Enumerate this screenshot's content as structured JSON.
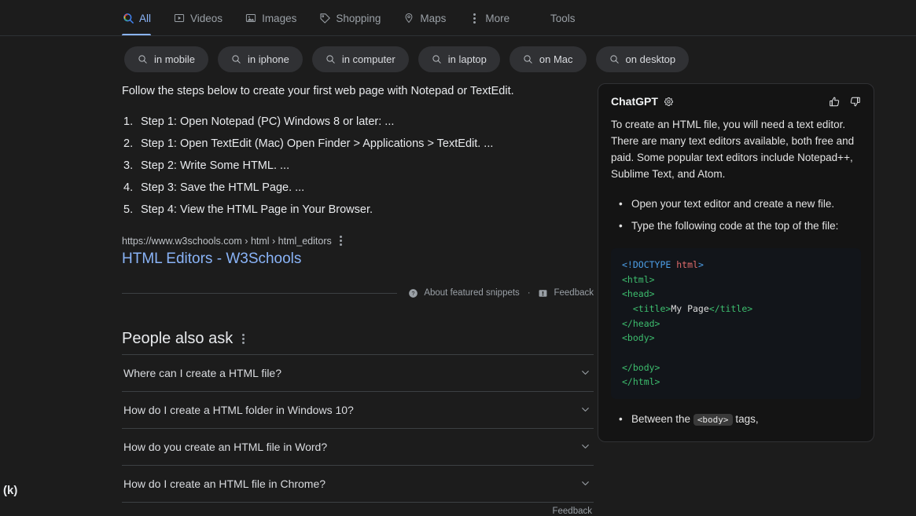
{
  "nav": {
    "tabs": [
      {
        "label": "All",
        "icon": "google-search-icon",
        "active": true
      },
      {
        "label": "Videos",
        "icon": "video-icon",
        "active": false
      },
      {
        "label": "Images",
        "icon": "image-icon",
        "active": false
      },
      {
        "label": "Shopping",
        "icon": "tag-icon",
        "active": false
      },
      {
        "label": "Maps",
        "icon": "map-pin-icon",
        "active": false
      },
      {
        "label": "More",
        "icon": "kebab-icon",
        "active": false
      }
    ],
    "tools_label": "Tools"
  },
  "chips": [
    {
      "label": "in mobile"
    },
    {
      "label": "in iphone"
    },
    {
      "label": "in computer"
    },
    {
      "label": "in laptop"
    },
    {
      "label": "on Mac"
    },
    {
      "label": "on desktop"
    }
  ],
  "snippet": {
    "lead": "Follow the steps below to create your first web page with Notepad or TextEdit.",
    "steps": [
      "Step 1: Open Notepad (PC) Windows 8 or later: ...",
      "Step 1: Open TextEdit (Mac) Open Finder > Applications > TextEdit. ...",
      "Step 2: Write Some HTML. ...",
      "Step 3: Save the HTML Page. ...",
      "Step 4: View the HTML Page in Your Browser."
    ],
    "breadcrumb": "https://www.w3schools.com › html › html_editors",
    "title": "HTML Editors - W3Schools",
    "about_label": "About featured snippets",
    "dot": "·",
    "feedback_label": "Feedback"
  },
  "paa": {
    "title": "People also ask",
    "questions": [
      "Where can I create a HTML file?",
      "How do I create a HTML folder in Windows 10?",
      "How do you create an HTML file in Word?",
      "How do I create an HTML file in Chrome?"
    ],
    "feedback_label": "Feedback"
  },
  "gpt": {
    "name": "ChatGPT",
    "paragraph": "To create an HTML file, you will need a text editor. There are many text editors available, both free and paid. Some popular text editors include Notepad++, Sublime Text, and Atom.",
    "bullets": [
      "Open your text editor and create a new file.",
      "Type the following code at the top of the file:"
    ],
    "code_lines": [
      [
        {
          "t": "<!DOCTYPE",
          "c": "punct"
        },
        {
          "t": " ",
          "c": "text"
        },
        {
          "t": "html",
          "c": "attr"
        },
        {
          "t": ">",
          "c": "punct"
        }
      ],
      [
        {
          "t": "<html>",
          "c": "tag"
        }
      ],
      [
        {
          "t": "<head>",
          "c": "tag"
        }
      ],
      [
        {
          "t": "  <title>",
          "c": "tag"
        },
        {
          "t": "My Page",
          "c": "text"
        },
        {
          "t": "</title>",
          "c": "tag"
        }
      ],
      [
        {
          "t": "</head>",
          "c": "tag"
        }
      ],
      [
        {
          "t": "<body>",
          "c": "tag"
        }
      ],
      [
        {
          "t": "",
          "c": "text"
        }
      ],
      [
        {
          "t": "</body>",
          "c": "tag"
        }
      ],
      [
        {
          "t": "</html>",
          "c": "tag"
        }
      ]
    ],
    "trailing_bullet_pre": "Between the ",
    "trailing_bullet_code": "<body>",
    "trailing_bullet_post": " tags,"
  },
  "figure": {
    "label": "(k)"
  },
  "colors": {
    "page_bg": "#1c1c1c",
    "panel_bg": "#141414",
    "code_bg": "#12151a",
    "accent_blue": "#8ab4f8",
    "chip_bg": "#303134",
    "muted_text": "#9aa0a6",
    "body_text": "#e8eaed",
    "code_tag": "#3dbd6e",
    "code_punct": "#4d9fe8",
    "code_attr": "#e06c6c"
  }
}
